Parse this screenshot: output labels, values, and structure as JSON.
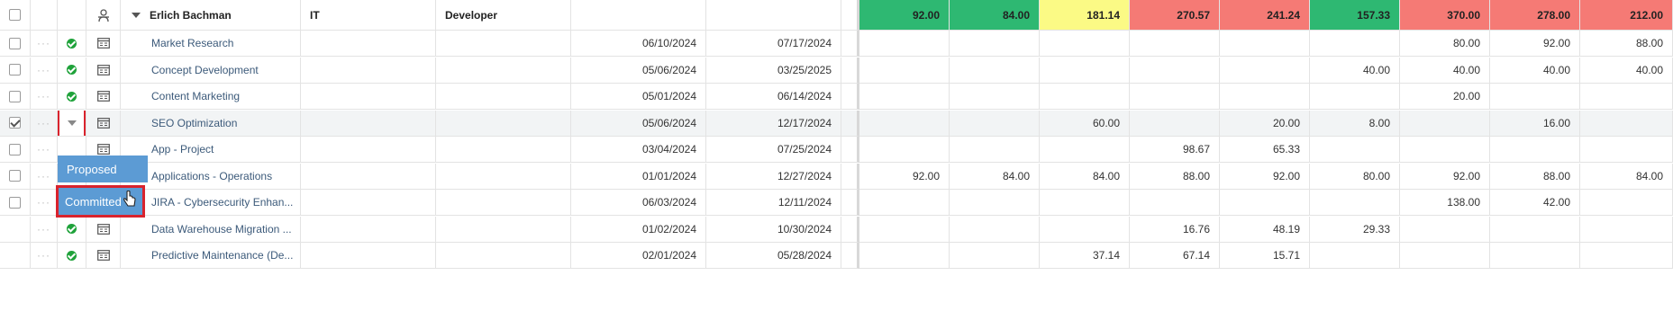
{
  "header": {
    "name": "Erlich Bachman",
    "department": "IT",
    "role": "Developer",
    "totals": [
      {
        "value": "92.00",
        "color": "#2eb872"
      },
      {
        "value": "84.00",
        "color": "#2eb872"
      },
      {
        "value": "181.14",
        "color": "#fbfa85"
      },
      {
        "value": "270.57",
        "color": "#f57a75"
      },
      {
        "value": "241.24",
        "color": "#f57a75"
      },
      {
        "value": "157.33",
        "color": "#2eb872"
      },
      {
        "value": "370.00",
        "color": "#f57a75"
      },
      {
        "value": "278.00",
        "color": "#f57a75"
      },
      {
        "value": "212.00",
        "color": "#f57a75"
      }
    ]
  },
  "rows": [
    {
      "name": "Market Research",
      "start": "06/10/2024",
      "end": "07/17/2024",
      "vals": [
        "",
        "",
        "",
        "",
        "",
        "",
        "80.00",
        "92.00",
        "88.00"
      ]
    },
    {
      "name": "Concept Development",
      "start": "05/06/2024",
      "end": "03/25/2025",
      "vals": [
        "",
        "",
        "",
        "",
        "",
        "40.00",
        "40.00",
        "40.00",
        "40.00"
      ]
    },
    {
      "name": "Content Marketing",
      "start": "05/01/2024",
      "end": "06/14/2024",
      "vals": [
        "",
        "",
        "",
        "",
        "",
        "",
        "20.00",
        "",
        ""
      ]
    },
    {
      "name": "SEO Optimization",
      "start": "05/06/2024",
      "end": "12/17/2024",
      "vals": [
        "",
        "",
        "60.00",
        "",
        "20.00",
        "8.00",
        "",
        "16.00",
        ""
      ]
    },
    {
      "name": "App - Project",
      "start": "03/04/2024",
      "end": "07/25/2024",
      "vals": [
        "",
        "",
        "",
        "98.67",
        "65.33",
        "",
        "",
        "",
        ""
      ]
    },
    {
      "name": "Applications - Operations",
      "start": "01/01/2024",
      "end": "12/27/2024",
      "vals": [
        "92.00",
        "84.00",
        "84.00",
        "88.00",
        "92.00",
        "80.00",
        "92.00",
        "88.00",
        "84.00"
      ]
    },
    {
      "name": "JIRA - Cybersecurity Enhan...",
      "start": "06/03/2024",
      "end": "12/11/2024",
      "vals": [
        "",
        "",
        "",
        "",
        "",
        "",
        "138.00",
        "42.00",
        ""
      ]
    },
    {
      "name": "Data Warehouse Migration ...",
      "start": "01/02/2024",
      "end": "10/30/2024",
      "vals": [
        "",
        "",
        "",
        "16.76",
        "48.19",
        "29.33",
        "",
        "",
        ""
      ]
    },
    {
      "name": "Predictive Maintenance (De...",
      "start": "02/01/2024",
      "end": "05/28/2024",
      "vals": [
        "",
        "",
        "37.14",
        "67.14",
        "15.71",
        "",
        "",
        "",
        ""
      ]
    }
  ],
  "dropdown": {
    "options": [
      "Proposed",
      "Committed"
    ]
  },
  "icons": {
    "dots": "···"
  }
}
